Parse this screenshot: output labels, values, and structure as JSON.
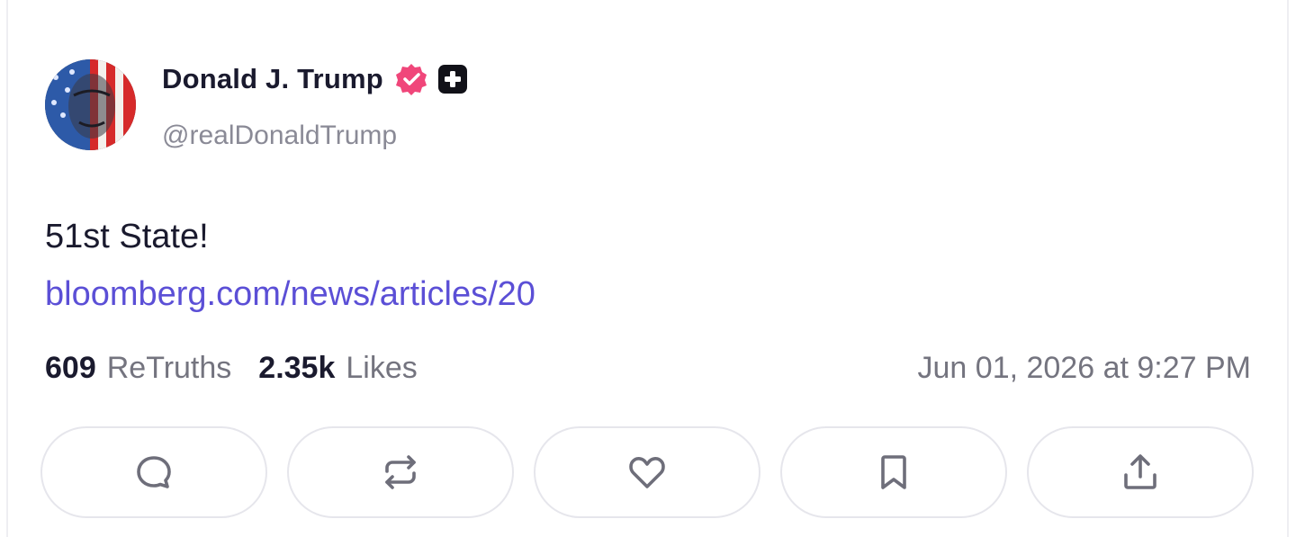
{
  "author": {
    "display_name": "Donald J. Trump",
    "handle": "@realDonaldTrump",
    "verified_icon": "verified-badge-icon",
    "verified_color": "#f0467a",
    "plus_icon": "plus-badge-icon"
  },
  "post": {
    "text": "51st State!",
    "link": "bloomberg.com/news/articles/20",
    "link_color": "#5b4fd6"
  },
  "stats": {
    "retruths_count": "609",
    "retruths_label": "ReTruths",
    "likes_count": "2.35k",
    "likes_label": "Likes",
    "timestamp": "Jun 01, 2026 at 9:27 PM"
  },
  "actions": [
    {
      "name": "reply",
      "icon": "comment-icon"
    },
    {
      "name": "retruth",
      "icon": "repost-icon"
    },
    {
      "name": "like",
      "icon": "heart-icon"
    },
    {
      "name": "bookmark",
      "icon": "bookmark-icon"
    },
    {
      "name": "share",
      "icon": "share-icon"
    }
  ]
}
